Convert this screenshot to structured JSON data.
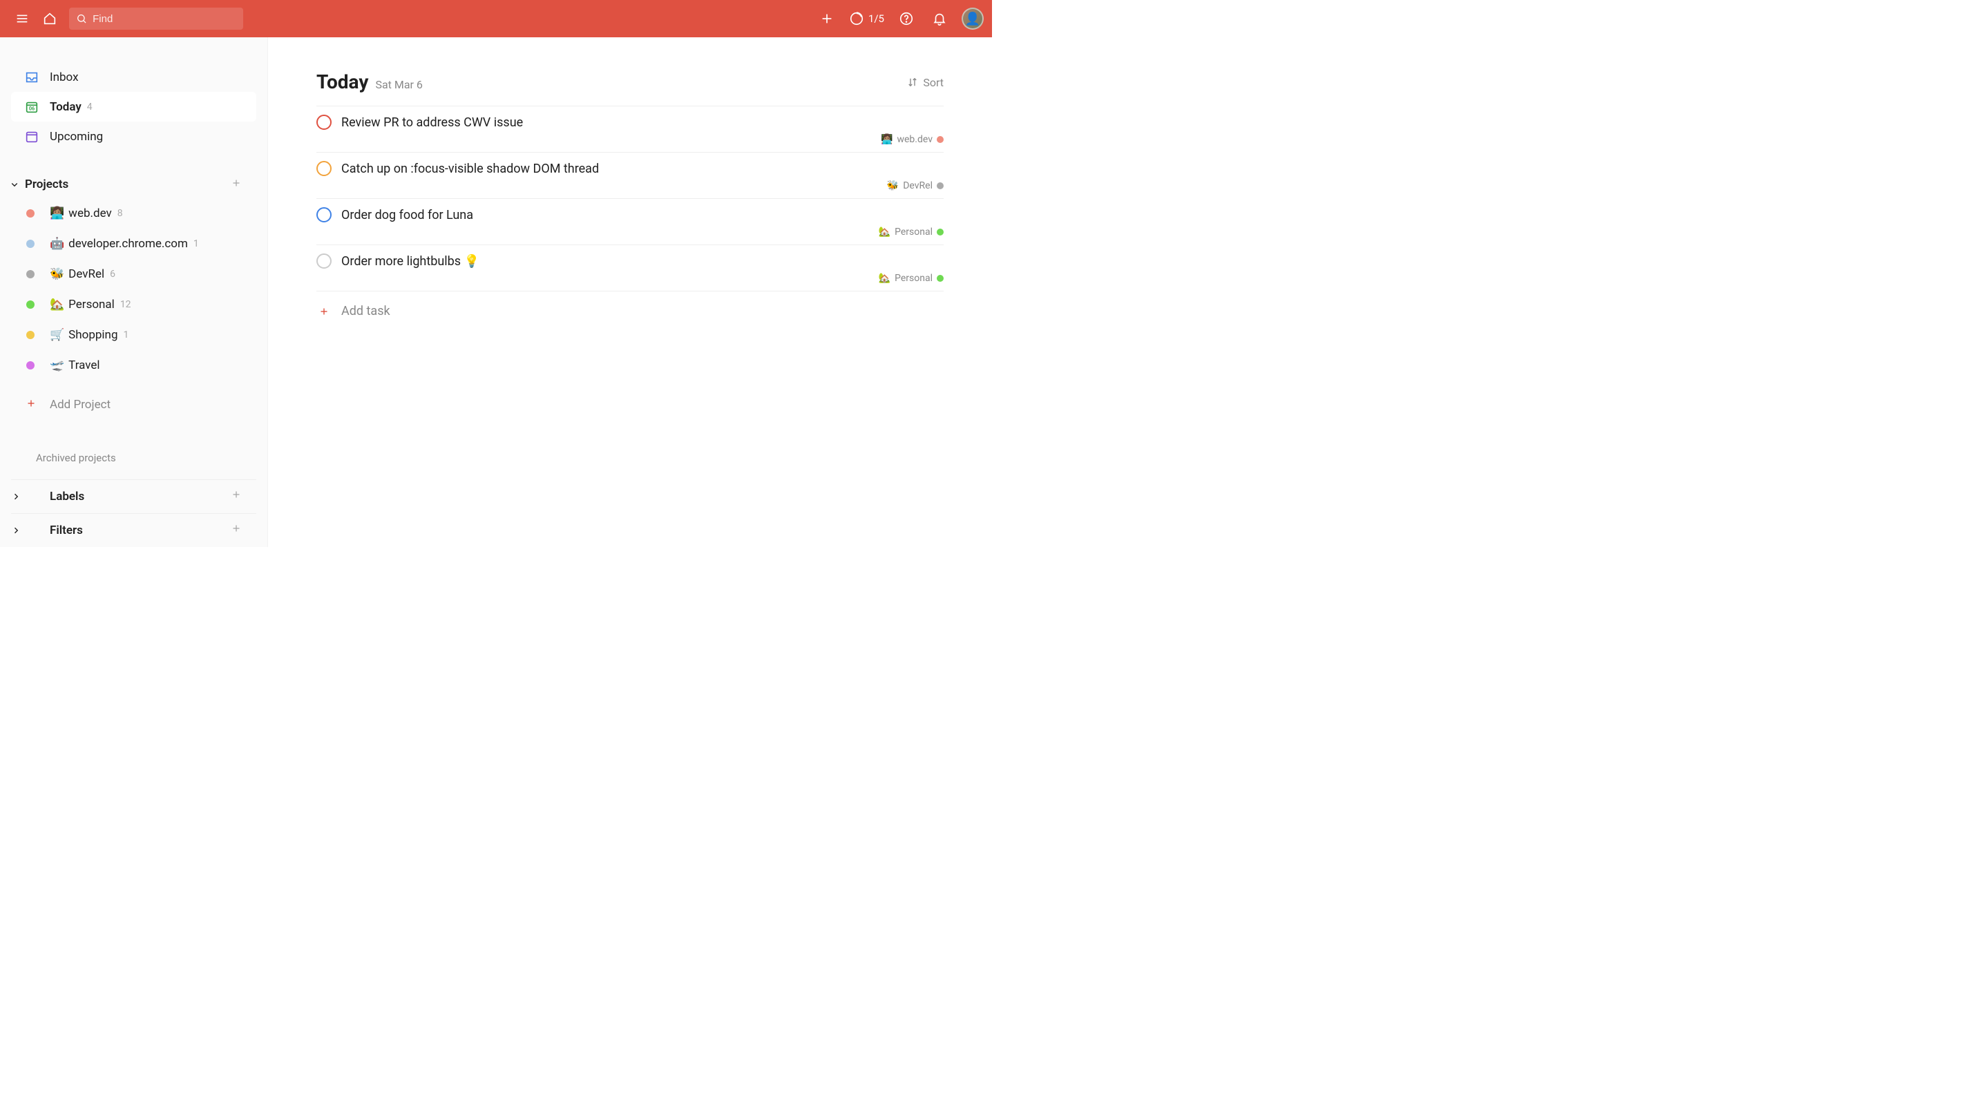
{
  "header": {
    "search_placeholder": "Find",
    "productivity": "1/5"
  },
  "sidebar": {
    "nav": [
      {
        "label": "Inbox",
        "count": "",
        "icon": "inbox",
        "color": "#3f82e6"
      },
      {
        "label": "Today",
        "count": "4",
        "icon": "today",
        "color": "#2f9e44"
      },
      {
        "label": "Upcoming",
        "count": "",
        "icon": "upcoming",
        "color": "#7c4dd4"
      }
    ],
    "projects_header": "Projects",
    "projects": [
      {
        "emoji": "👩🏽‍💻",
        "label": "web.dev",
        "count": "8",
        "color": "#f08d7e"
      },
      {
        "emoji": "🤖",
        "label": "developer.chrome.com",
        "count": "1",
        "color": "#a8c8e6"
      },
      {
        "emoji": "🐝",
        "label": "DevRel",
        "count": "6",
        "color": "#aaaaaa"
      },
      {
        "emoji": "🏡",
        "label": "Personal",
        "count": "12",
        "color": "#6fd952"
      },
      {
        "emoji": "🛒",
        "label": "Shopping",
        "count": "1",
        "color": "#f2c94c"
      },
      {
        "emoji": "🛫",
        "label": "Travel",
        "count": "",
        "color": "#d672e8"
      }
    ],
    "add_project": "Add Project",
    "archived": "Archived projects",
    "labels_header": "Labels",
    "filters_header": "Filters"
  },
  "main": {
    "title": "Today",
    "date": "Sat Mar 6",
    "sort_label": "Sort",
    "add_task": "Add task",
    "tasks": [
      {
        "title": "Review PR to address CWV issue",
        "check_color": "#df5141",
        "project_emoji": "👩🏽‍💻",
        "project_label": "web.dev",
        "project_color": "#f08d7e"
      },
      {
        "title": "Catch up on :focus-visible shadow DOM thread",
        "check_color": "#f2a33c",
        "project_emoji": "🐝",
        "project_label": "DevRel",
        "project_color": "#aaaaaa"
      },
      {
        "title": "Order dog food for Luna",
        "check_color": "#3f82e6",
        "project_emoji": "🏡",
        "project_label": "Personal",
        "project_color": "#6fd952"
      },
      {
        "title": "Order more lightbulbs 💡",
        "check_color": "#cccccc",
        "project_emoji": "🏡",
        "project_label": "Personal",
        "project_color": "#6fd952"
      }
    ]
  }
}
